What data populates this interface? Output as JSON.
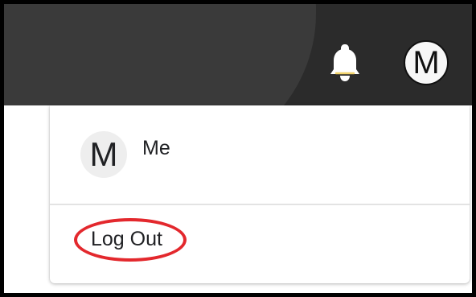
{
  "header": {
    "avatar_initial": "M",
    "icons": {
      "notifications": "bell-icon"
    }
  },
  "dropdown": {
    "profile": {
      "initial": "M",
      "name": "Me"
    },
    "logout_label": "Log Out"
  },
  "colors": {
    "topbar": "#2b2b2b",
    "highlight": "#e3282d",
    "bell": "#ffffff"
  }
}
